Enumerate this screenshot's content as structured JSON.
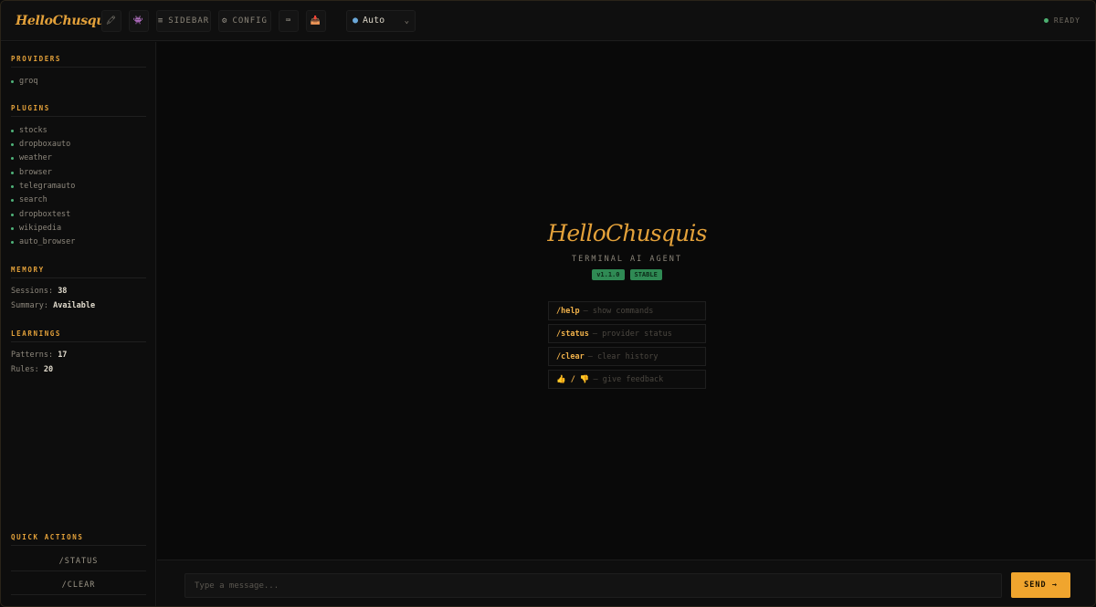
{
  "header": {
    "brand": "HelloChusquis",
    "pin_icon": "🖍",
    "bot_icon": "👾",
    "sidebar_icon": "≡",
    "sidebar_label": "SIDEBAR",
    "config_icon": "⚙",
    "config_label": "CONFIG",
    "keyboard_icon": "⌨",
    "download_icon": "📥",
    "model": "Auto",
    "status": "READY"
  },
  "sidebar": {
    "providers_title": "PROVIDERS",
    "providers": [
      "groq"
    ],
    "plugins_title": "PLUGINS",
    "plugins": [
      "stocks",
      "dropboxauto",
      "weather",
      "browser",
      "telegramauto",
      "search",
      "dropboxtest",
      "wikipedia",
      "auto_browser"
    ],
    "memory_title": "MEMORY",
    "sessions_label": "Sessions:",
    "sessions_value": "38",
    "summary_label": "Summary:",
    "summary_value": "Available",
    "learnings_title": "LEARNINGS",
    "patterns_label": "Patterns:",
    "patterns_value": "17",
    "rules_label": "Rules:",
    "rules_value": "20",
    "quick_actions_title": "QUICK ACTIONS",
    "quick_actions": [
      "/STATUS",
      "/CLEAR"
    ]
  },
  "hero": {
    "title": "HelloChusquis",
    "subtitle": "TERMINAL AI AGENT",
    "version": "v1.1.0",
    "channel": "STABLE",
    "commands": [
      {
        "key": "/help",
        "desc": "— show commands"
      },
      {
        "key": "/status",
        "desc": "— provider status"
      },
      {
        "key": "/clear",
        "desc": "— clear history"
      },
      {
        "key": "👍 / 👎",
        "desc": "— give feedback"
      }
    ]
  },
  "input": {
    "placeholder": "Type a message...",
    "send_label": "SEND →"
  },
  "colors": {
    "accent": "#e3a13a",
    "send": "#f0a52e",
    "status_green": "#4caf70",
    "badge_green": "#2f8a54",
    "background": "#0a0a0a"
  }
}
